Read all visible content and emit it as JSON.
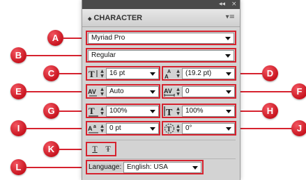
{
  "panel": {
    "window_controls": [
      "◂◂",
      "×"
    ],
    "title": "CHARACTER",
    "title_caret": "◆",
    "menu_glyph": "▾≡"
  },
  "font_family": {
    "value": "Myriad Pro",
    "callout": "A"
  },
  "font_style": {
    "value": "Regular",
    "callout": "B"
  },
  "font_size": {
    "value": "16 pt",
    "icon": "font-size-icon",
    "callout": "C"
  },
  "leading": {
    "value": "(19.2 pt)",
    "icon": "leading-icon",
    "callout": "D"
  },
  "kerning": {
    "value": "Auto",
    "icon": "kerning-icon",
    "callout": "E"
  },
  "tracking": {
    "value": "0",
    "icon": "tracking-icon",
    "callout": "F"
  },
  "horizontal_scale": {
    "value": "100%",
    "icon": "horizontal-scale-icon",
    "callout": "G"
  },
  "vertical_scale": {
    "value": "100%",
    "icon": "vertical-scale-icon",
    "callout": "H"
  },
  "baseline_shift": {
    "value": "0 pt",
    "icon": "baseline-shift-icon",
    "callout": "I"
  },
  "character_rotation": {
    "value": "0°",
    "icon": "character-rotation-icon",
    "callout": "J"
  },
  "text_buttons": {
    "callout": "K",
    "underline_glyph": "T",
    "strikethrough_glyph": "Ŧ"
  },
  "language": {
    "label": "Language:",
    "value": "English: USA",
    "callout": "L"
  },
  "colors": {
    "highlight": "#d6222e",
    "panel": "#d3d3d3"
  }
}
